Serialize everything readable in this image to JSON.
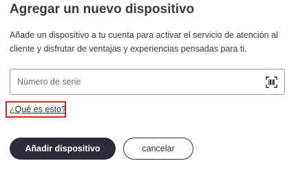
{
  "dialog": {
    "title": "Agregar un nuevo dispositivo",
    "description": "Añade un dispositivo a tu cuenta para activar el servicio de atención al cliente y disfrutar de ventajas y experiencias pensadas para ti."
  },
  "serial_input": {
    "placeholder": "Número de serie",
    "value": "",
    "icon": "barcode-scan-icon"
  },
  "help_link": {
    "label": "¿Qué es esto?",
    "highlight_color": "#e0201e"
  },
  "actions": {
    "add_label": "Añadir dispositivo",
    "cancel_label": "cancelar"
  },
  "colors": {
    "primary": "#2f2b3d",
    "text": "#2b2b2b"
  }
}
